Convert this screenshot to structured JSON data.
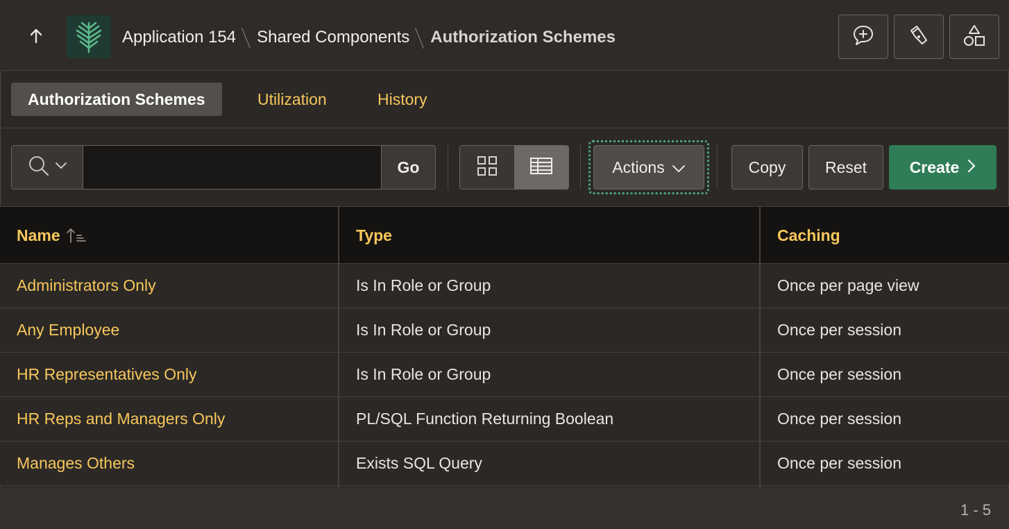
{
  "header": {
    "breadcrumb": [
      "Application 154",
      "Shared Components",
      "Authorization Schemes"
    ]
  },
  "tabs": [
    {
      "label": "Authorization Schemes",
      "active": true
    },
    {
      "label": "Utilization",
      "active": false
    },
    {
      "label": "History",
      "active": false
    }
  ],
  "toolbar": {
    "search_value": "",
    "go_label": "Go",
    "actions_label": "Actions",
    "copy_label": "Copy",
    "reset_label": "Reset",
    "create_label": "Create"
  },
  "table": {
    "columns": [
      "Name",
      "Type",
      "Caching"
    ],
    "sort": {
      "column": "Name",
      "direction": "ascending"
    },
    "rows": [
      {
        "name": "Administrators Only",
        "type": "Is In Role or Group",
        "caching": "Once per page view"
      },
      {
        "name": "Any Employee",
        "type": "Is In Role or Group",
        "caching": "Once per session"
      },
      {
        "name": "HR Representatives Only",
        "type": "Is In Role or Group",
        "caching": "Once per session"
      },
      {
        "name": "HR Reps and Managers Only",
        "type": "PL/SQL Function Returning Boolean",
        "caching": "Once per session"
      },
      {
        "name": "Manages Others",
        "type": "Exists SQL Query",
        "caching": "Once per session"
      }
    ]
  },
  "pagination": "1 - 5",
  "colors": {
    "accent_link": "#f7c75b",
    "create_button": "#2f7d57",
    "focus_ring": "#4da37b",
    "logo_bg": "#1f3a33",
    "logo_leaf": "#5cb88a"
  }
}
